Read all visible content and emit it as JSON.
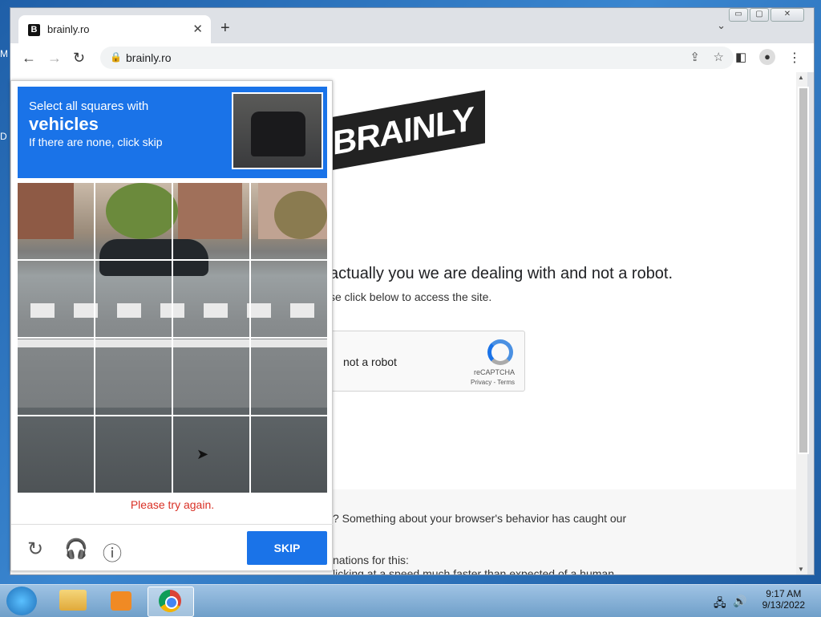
{
  "desktop": {
    "icon1": "M",
    "icon2": "D"
  },
  "window": {
    "min": "▭",
    "max": "▢",
    "close": "✕"
  },
  "browser": {
    "tab_title": "brainly.ro",
    "tab_favicon": "B",
    "new_tab": "+",
    "url": "brainly.ro"
  },
  "page": {
    "logo": "BRAINLY",
    "heading": "actually you we are dealing with and not a robot.",
    "subtext": "se click below to access the site.",
    "recaptcha_label": "not a robot",
    "recaptcha_brand": "reCAPTCHA",
    "recaptcha_links": "Privacy - Terms",
    "gray_line1": "? Something about your browser's behavior has caught our",
    "gray_line2": "nations for this:",
    "gray_line3": "licking at a speed much faster than expected of a human"
  },
  "captcha": {
    "line1": "Select all squares with",
    "line2": "vehicles",
    "line3": "If there are none, click skip",
    "error": "Please try again.",
    "skip_label": "SKIP"
  },
  "taskbar": {
    "time": "9:17 AM",
    "date": "9/13/2022"
  },
  "colors": {
    "accent": "#1a73e8",
    "error": "#d93025"
  }
}
